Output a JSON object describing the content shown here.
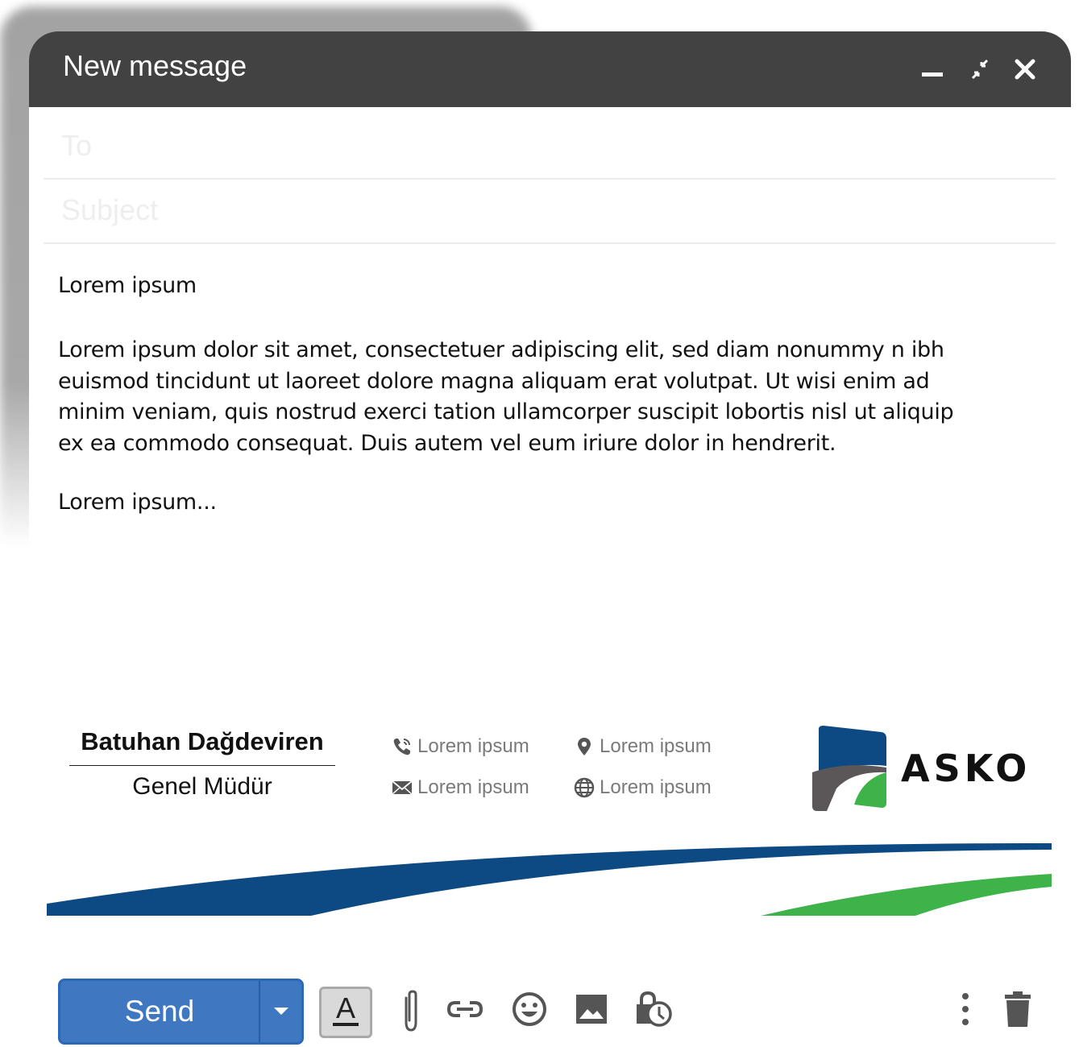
{
  "window": {
    "title": "New message",
    "controls": [
      "minimize-icon",
      "exit-fullscreen-icon",
      "close-icon"
    ]
  },
  "fields": {
    "to_placeholder": "To",
    "subject_placeholder": "Subject"
  },
  "body": {
    "greeting": "Lorem ipsum",
    "paragraph": "Lorem ipsum dolor sit amet, consectetuer adipiscing elit, sed diam nonummy n ibh euismod tincidunt ut laoreet dolore magna aliquam erat volutpat. Ut wisi enim ad minim veniam, quis nostrud exerci tation ullamcorper suscipit lobortis nisl ut aliquip ex ea commodo consequat. Duis autem vel eum iriure dolor in hendrerit.",
    "closing": "Lorem ipsum..."
  },
  "signature": {
    "name": "Batuhan Dağdeviren",
    "role": "Genel Müdür",
    "phone": "Lorem ipsum",
    "email": "Lorem ipsum",
    "location": "Lorem ipsum",
    "website": "Lorem ipsum",
    "company": "ASKO",
    "colors": {
      "blue": "#0d4a84",
      "green": "#3db34a",
      "gray": "#5b5657"
    }
  },
  "toolbar": {
    "send_label": "Send",
    "format_label": "A",
    "tools": [
      "formatting-icon",
      "attach-icon",
      "link-icon",
      "emoji-icon",
      "image-icon",
      "confidential-icon",
      "more-options-icon",
      "delete-icon"
    ],
    "send_color": "#3f78c1"
  }
}
